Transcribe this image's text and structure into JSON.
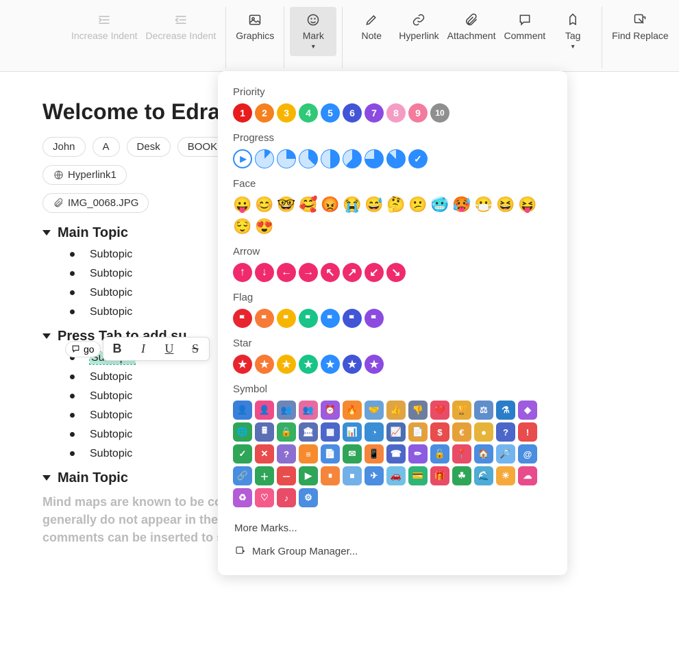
{
  "toolbar": {
    "increase_indent": "Increase Indent",
    "decrease_indent": "Decrease Indent",
    "graphics": "Graphics",
    "mark": "Mark",
    "note": "Note",
    "hyperlink": "Hyperlink",
    "attachment": "Attachment",
    "comment": "Comment",
    "tag": "Tag",
    "find_replace": "Find Replace"
  },
  "content": {
    "title": "Welcome to EdrawMind",
    "tags": [
      "John",
      "A",
      "Desk",
      "BOOK"
    ],
    "hyperlink_label": "Hyperlink1",
    "attachment_label": "IMG_0068.JPG",
    "topics": [
      {
        "label": "Main Topic",
        "subs": [
          "Subtopic",
          "Subtopic",
          "Subtopic",
          "Subtopic"
        ]
      },
      {
        "label": "Press Tab to add su",
        "has_input": true,
        "input_text": "go",
        "subs": [
          "Subtopic",
          "Subtopic",
          "Subtopic",
          "Subtopic",
          "Subtopic",
          "Subtopic"
        ],
        "selected_index": 0
      },
      {
        "label": "Main Topic",
        "desc": "Mind maps are known to be concise and to the point, and detailed descriptions generally do not appear in the subject text. For topics that require more detail, comments can be inserted to supplement the information, and these may"
      }
    ]
  },
  "mini_toolbar": {
    "bold": "B",
    "italic": "I",
    "underline": "U",
    "strike": "S"
  },
  "panel": {
    "sections": {
      "priority": {
        "label": "Priority",
        "items": [
          {
            "t": "1",
            "bg": "#e81c1c"
          },
          {
            "t": "2",
            "bg": "#f5801f"
          },
          {
            "t": "3",
            "bg": "#f8b500"
          },
          {
            "t": "4",
            "bg": "#2fc978"
          },
          {
            "t": "5",
            "bg": "#2b8dff"
          },
          {
            "t": "6",
            "bg": "#4155d6"
          },
          {
            "t": "7",
            "bg": "#8b4be0"
          },
          {
            "t": "8",
            "bg": "#f59cc4"
          },
          {
            "t": "9",
            "bg": "#f47b9e"
          },
          {
            "t": "10",
            "bg": "#8f8f8f"
          }
        ]
      },
      "progress": {
        "label": "Progress",
        "items": [
          {
            "pct": 0,
            "play": true
          },
          {
            "pct": 12
          },
          {
            "pct": 25
          },
          {
            "pct": 37
          },
          {
            "pct": 50
          },
          {
            "pct": 62
          },
          {
            "pct": 75
          },
          {
            "pct": 87
          },
          {
            "pct": 100,
            "check": true
          }
        ]
      },
      "face": {
        "label": "Face",
        "items": [
          "😛",
          "😊",
          "🤓",
          "🥰",
          "😡",
          "😭",
          "😅",
          "🤔",
          "😕",
          "🥶",
          "🥵",
          "😷",
          "😆",
          "😝",
          "😌",
          "😍"
        ]
      },
      "arrow": {
        "label": "Arrow",
        "items": [
          "↑",
          "↓",
          "←",
          "→",
          "↖",
          "↗",
          "↙",
          "↘"
        ],
        "bg": "#ef2b6d"
      },
      "flag": {
        "label": "Flag",
        "items": [
          {
            "bg": "#e8252e"
          },
          {
            "bg": "#f77a36"
          },
          {
            "bg": "#f8b500"
          },
          {
            "bg": "#18c488"
          },
          {
            "bg": "#2b8dff"
          },
          {
            "bg": "#4155d6"
          },
          {
            "bg": "#8b4be0"
          }
        ]
      },
      "star": {
        "label": "Star",
        "items": [
          {
            "bg": "#e8252e"
          },
          {
            "bg": "#f77a36"
          },
          {
            "bg": "#f8b500"
          },
          {
            "bg": "#18c488"
          },
          {
            "bg": "#2b8dff"
          },
          {
            "bg": "#4155d6"
          },
          {
            "bg": "#8b4be0"
          }
        ]
      },
      "symbol": {
        "label": "Symbol",
        "items": [
          {
            "g": "👤",
            "bg": "#3a7fd9"
          },
          {
            "g": "👤",
            "bg": "#ef4c8b"
          },
          {
            "g": "👥",
            "bg": "#6d86b8"
          },
          {
            "g": "👥",
            "bg": "#e86aa0"
          },
          {
            "g": "⏰",
            "bg": "#9d5be0"
          },
          {
            "g": "🔥",
            "bg": "#f58b2e"
          },
          {
            "g": "🤝",
            "bg": "#6aa3d9"
          },
          {
            "g": "👍",
            "bg": "#e0a442"
          },
          {
            "g": "👎",
            "bg": "#6d7da0"
          },
          {
            "g": "💔",
            "bg": "#e84c67"
          },
          {
            "g": "🏆",
            "bg": "#e6a935"
          },
          {
            "g": "⚖",
            "bg": "#5f8ecb"
          },
          {
            "g": "⚗",
            "bg": "#2a7ec9"
          },
          {
            "g": "◆",
            "bg": "#9d5be0"
          },
          {
            "g": "🌐",
            "bg": "#2fa558"
          },
          {
            "g": "🖩",
            "bg": "#5b6fb5"
          },
          {
            "g": "🔒",
            "bg": "#34b060"
          },
          {
            "g": "🏛",
            "bg": "#5b6fb5"
          },
          {
            "g": "▦",
            "bg": "#4b67c9"
          },
          {
            "g": "📊",
            "bg": "#3a8ed6"
          },
          {
            "g": "◔",
            "bg": "#3a8ed6"
          },
          {
            "g": "📈",
            "bg": "#4a6fb5"
          },
          {
            "g": "📄",
            "bg": "#e6a038"
          },
          {
            "g": "$",
            "bg": "#e84c4c"
          },
          {
            "g": "€",
            "bg": "#e6a038"
          },
          {
            "g": "●",
            "bg": "#e6b43a"
          },
          {
            "g": "?",
            "bg": "#4b67c9"
          },
          {
            "g": "!",
            "bg": "#e84c4c"
          },
          {
            "g": "✓",
            "bg": "#2fa558"
          },
          {
            "g": "✕",
            "bg": "#e84c4c"
          },
          {
            "g": "?",
            "bg": "#8b6fd0"
          },
          {
            "g": "≡",
            "bg": "#f58b2e"
          },
          {
            "g": "📄",
            "bg": "#4b8de0"
          },
          {
            "g": "✉",
            "bg": "#2fa558"
          },
          {
            "g": "📱",
            "bg": "#f5853a"
          },
          {
            "g": "☎",
            "bg": "#4b67c9"
          },
          {
            "g": "✏",
            "bg": "#8b5be0"
          },
          {
            "g": "🔓",
            "bg": "#4b8de0"
          },
          {
            "g": "📍",
            "bg": "#e84c67"
          },
          {
            "g": "🏠",
            "bg": "#4b8de0"
          },
          {
            "g": "🔎",
            "bg": "#72b5f0"
          },
          {
            "g": "@",
            "bg": "#4b8de0"
          },
          {
            "g": "🔗",
            "bg": "#4b8de0"
          },
          {
            "g": "＋",
            "bg": "#2fa558"
          },
          {
            "g": "－",
            "bg": "#e84c4c"
          },
          {
            "g": "▶",
            "bg": "#2fa558"
          },
          {
            "g": "⏸",
            "bg": "#f5853a"
          },
          {
            "g": "⏹",
            "bg": "#72b0e8"
          },
          {
            "g": "✈",
            "bg": "#4b8de0"
          },
          {
            "g": "🚗",
            "bg": "#72c0e8"
          },
          {
            "g": "💳",
            "bg": "#2fb578"
          },
          {
            "g": "🎁",
            "bg": "#e84c67"
          },
          {
            "g": "☘",
            "bg": "#2fa558"
          },
          {
            "g": "🌊",
            "bg": "#4facd6"
          },
          {
            "g": "☀",
            "bg": "#f5a93a"
          },
          {
            "g": "☁",
            "bg": "#e84c8b"
          },
          {
            "g": "♻",
            "bg": "#b45bd6"
          },
          {
            "g": "♡",
            "bg": "#f55a8a"
          },
          {
            "g": "♪",
            "bg": "#e84c67"
          },
          {
            "g": "⚙",
            "bg": "#4b8de0"
          }
        ]
      }
    },
    "more_marks": "More Marks...",
    "mark_group_manager": "Mark Group Manager..."
  }
}
